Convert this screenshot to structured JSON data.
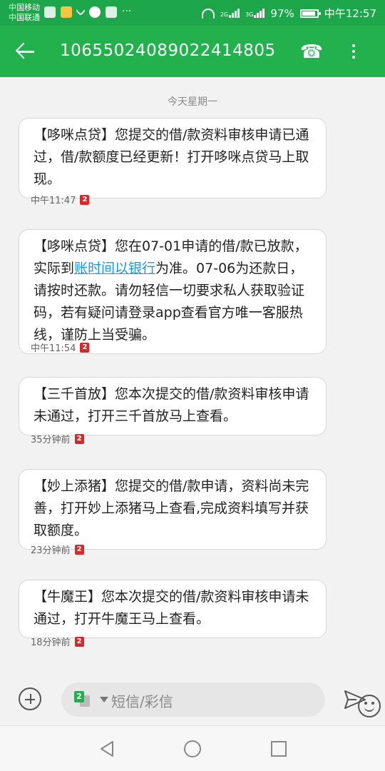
{
  "status_bar": {
    "carrier_1": "中国移动",
    "carrier_2": "中国联通",
    "network_1": "2G",
    "network_2": "3G",
    "battery": "97%",
    "time": "中午12:57"
  },
  "app_bar": {
    "title": "10655024089022414805"
  },
  "date_separator": "今天星期一",
  "messages": [
    {
      "text": "【哆咪点贷】您提交的借/款资料审核申请已通过，借/款额度已经更新！打开哆咪点贷马上取现。",
      "time": "中午11:47",
      "sim": "2"
    },
    {
      "text_before": "【哆咪点贷】您在07-01申请的借/款已放款，实际到",
      "link": "账时间以银行",
      "text_after": "为准。07-06为还款日，请按时还款。请勿轻信一切要求私人获取验证码，若有疑问请登录app查看官方唯一客服热线，谨防上当受骗。",
      "time": "中午11:54",
      "sim": "2"
    },
    {
      "text": "【三千首放】您本次提交的借/款资料审核申请未通过，打开三千首放马上查看。",
      "time": "35分钟前",
      "sim": "2"
    },
    {
      "text": "【妙上添猪】您提交的借/款申请，资料尚未完善，打开妙上添猪马上查看,完成资料填写并获取额度。",
      "time": "23分钟前",
      "sim": "2"
    },
    {
      "text": "【牛魔王】您本次提交的借/款资料审核申请未通过，打开牛魔王马上查看。",
      "time": "18分钟前",
      "sim": "2"
    }
  ],
  "input_bar": {
    "sim": "2",
    "placeholder": "短信/彩信"
  },
  "colors": {
    "app_bar": "#22b14c",
    "status_bar": "#1ea64a",
    "link": "#1a9ad6",
    "sim_badge": "#d62a2a"
  }
}
